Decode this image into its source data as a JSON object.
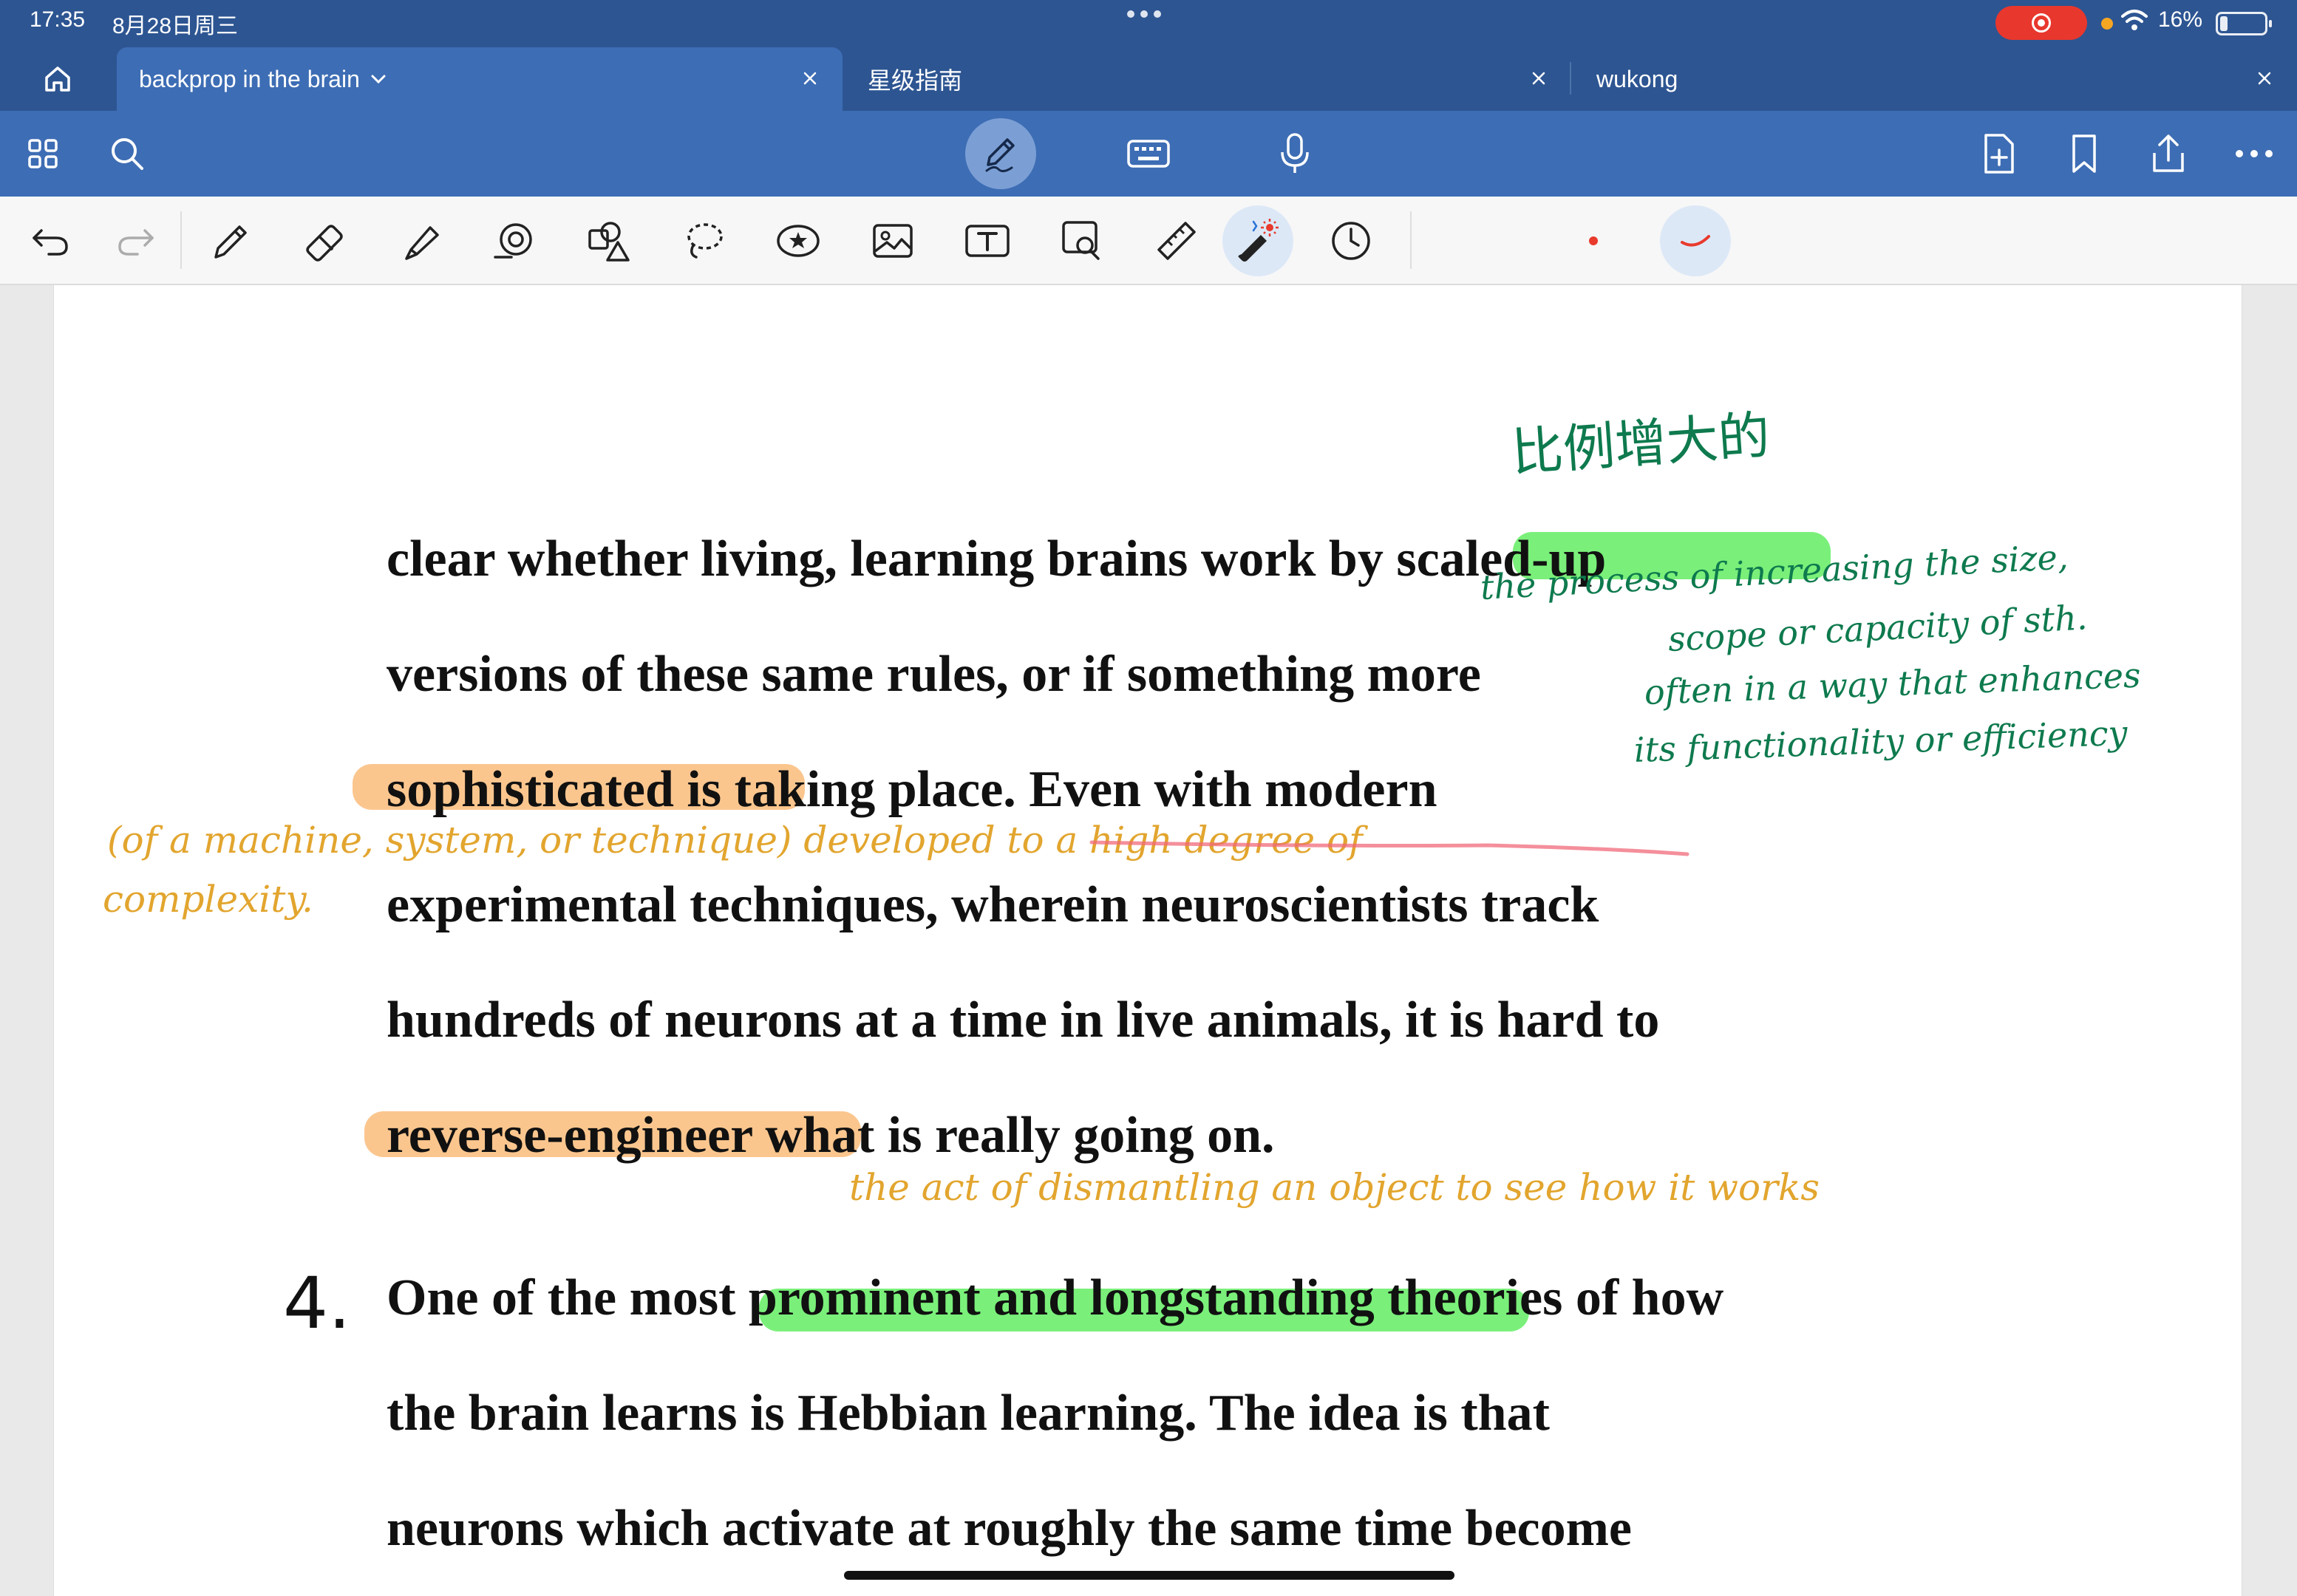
{
  "status_bar": {
    "time": "17:35",
    "date": "8月28日周三",
    "battery": "16%",
    "recording": true
  },
  "home_icon": "house-icon",
  "tabs": [
    {
      "label": "backprop in the brain",
      "active": true,
      "has_dropdown": true
    },
    {
      "label": "星级指南",
      "active": false
    },
    {
      "label": "wukong",
      "active": false
    }
  ],
  "toolbar": {
    "left": [
      "grid-icon",
      "search-icon"
    ],
    "center": [
      "handwriting-mode-icon",
      "keyboard-icon",
      "microphone-icon"
    ],
    "right": [
      "add-page-icon",
      "bookmark-icon",
      "share-icon",
      "more-icon"
    ]
  },
  "pen_tools": [
    "undo",
    "redo",
    "pen",
    "eraser",
    "highlighter",
    "shapes",
    "elements",
    "lasso",
    "stickers",
    "image",
    "text-box",
    "magnifier",
    "ruler",
    "laser-pointer",
    "recent"
  ],
  "colors": {
    "accent": "#2d5592",
    "toolbar": "#3d6db4",
    "highlight_green": "#7af07a",
    "highlight_orange": "#fbc68e",
    "ink_green": "#0e7a4e",
    "ink_orange": "#e2a52e",
    "pen_color": "#e83a2d"
  },
  "document": {
    "lines": [
      "clear whether living, learning brains work by scaled-up",
      "versions of these same rules, or if something more",
      "sophisticated is taking place. Even with modern",
      "experimental techniques, wherein neuroscientists track",
      "hundreds of neurons at a time in live animals, it is hard to",
      "reverse-engineer what is really going on.",
      "One of the most prominent and longstanding theories of how",
      "the brain learns is Hebbian learning. The idea is that",
      "neurons which activate at roughly the same time become"
    ],
    "item_number": "4."
  },
  "annotations": {
    "chinese_note": "比例增大的",
    "scaled_up_def": [
      "the process of increasing the size,",
      "scope or capacity of sth.",
      "often in a way that enhances",
      "its functionality or efficiency"
    ],
    "sophisticated_def_1": "(of a machine, system, or technique) developed to a high degree of",
    "sophisticated_def_2": "complexity.",
    "reverse_engineer_def": "the act of dismantling an object to see how it works"
  }
}
